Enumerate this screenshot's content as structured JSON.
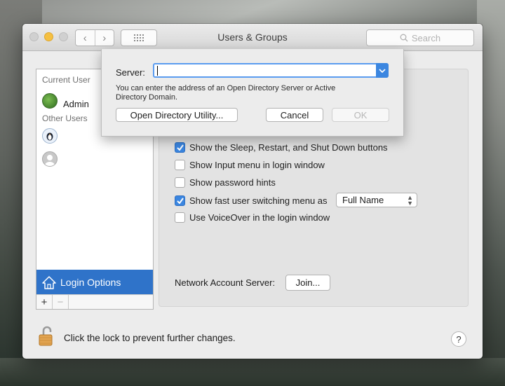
{
  "window": {
    "title": "Users & Groups",
    "search_placeholder": "Search",
    "nav_back": "‹",
    "nav_forward": "›"
  },
  "sidebar": {
    "current_user_label": "Current User",
    "current_user_name": "Admin",
    "other_users_label": "Other Users",
    "login_options_label": "Login Options",
    "add": "+",
    "remove": "−"
  },
  "options": {
    "sleep_restart": "Show the Sleep, Restart, and Shut Down buttons",
    "input_menu": "Show Input menu in login window",
    "password_hints": "Show password hints",
    "fast_user_switching": "Show fast user switching menu as",
    "fast_user_switching_value": "Full Name",
    "voiceover": "Use VoiceOver in the login window",
    "checked": {
      "sleep_restart": true,
      "input_menu": false,
      "password_hints": false,
      "fast_user_switching": true,
      "voiceover": false
    }
  },
  "network": {
    "label": "Network Account Server:",
    "join": "Join..."
  },
  "footer": {
    "lock_text": "Click the lock to prevent further changes.",
    "help": "?"
  },
  "sheet": {
    "server_label": "Server:",
    "server_value": "",
    "hint": "You can enter the address of an Open Directory Server or Active Directory Domain.",
    "open_directory_utility": "Open Directory Utility...",
    "cancel": "Cancel",
    "ok": "OK"
  },
  "colors": {
    "accent": "#3b86e0",
    "selection": "#2f73c9"
  }
}
